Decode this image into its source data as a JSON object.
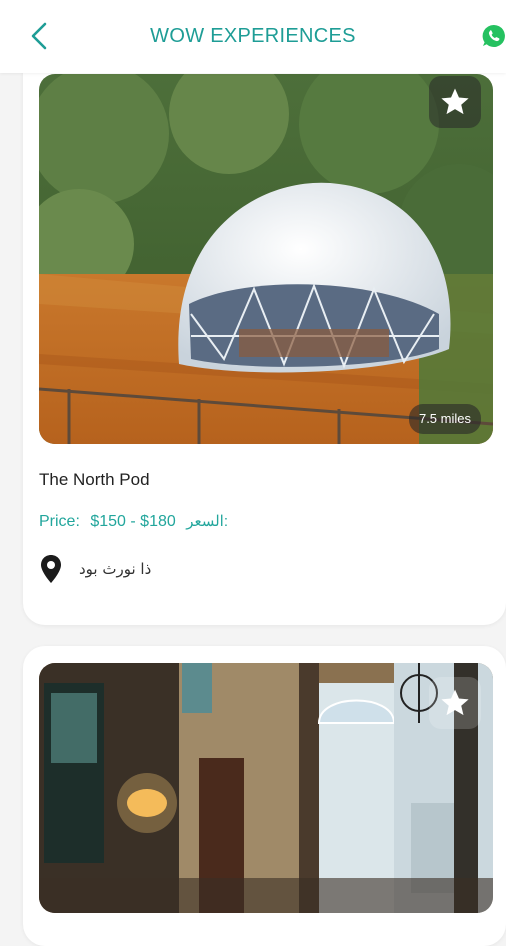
{
  "header": {
    "title": "WOW EXPERIENCES",
    "back_icon": "chevron-left-icon",
    "whatsapp_icon": "whatsapp-icon",
    "accent_color": "#1e9d96"
  },
  "experiences": [
    {
      "name": "The North Pod",
      "price_label": "Price:",
      "price_range": "$150 - $180",
      "price_label_ar": "السعر:",
      "location": "ذا نورث بود",
      "distance": "7.5 miles",
      "favorite_icon": "star-icon",
      "location_icon": "map-pin-icon"
    },
    {
      "favorite_icon": "star-icon"
    }
  ],
  "colors": {
    "price": "#22a69c",
    "background": "#f4f4f4",
    "card": "#ffffff"
  }
}
